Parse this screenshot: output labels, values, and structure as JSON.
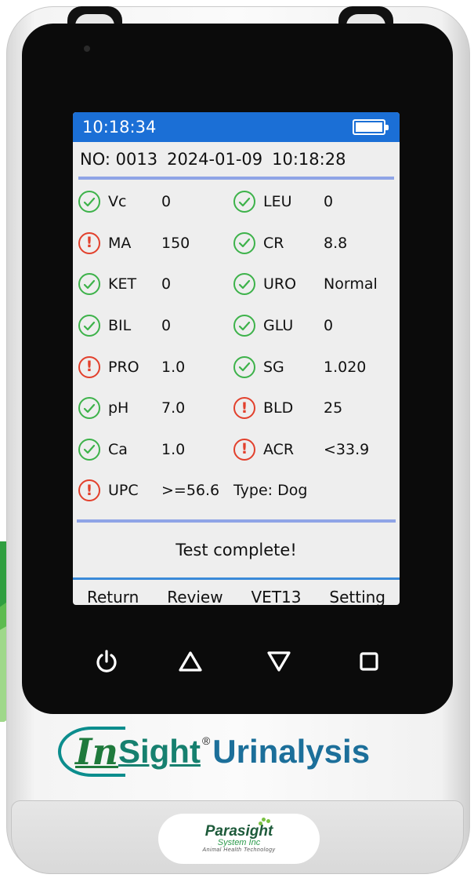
{
  "status_bar": {
    "time": "10:18:34",
    "battery_level": 1.0
  },
  "record": {
    "number": "NO: 0013",
    "date": "2024-01-09",
    "time": "10:18:28"
  },
  "results": [
    [
      {
        "name": "Vc",
        "value": "0",
        "status": "ok"
      },
      {
        "name": "LEU",
        "value": "0",
        "status": "ok"
      }
    ],
    [
      {
        "name": "MA",
        "value": "150",
        "status": "abnormal"
      },
      {
        "name": "CR",
        "value": "8.8",
        "status": "ok"
      }
    ],
    [
      {
        "name": "KET",
        "value": "0",
        "status": "ok"
      },
      {
        "name": "URO",
        "value": "Normal",
        "status": "ok"
      }
    ],
    [
      {
        "name": "BIL",
        "value": "0",
        "status": "ok"
      },
      {
        "name": "GLU",
        "value": "0",
        "status": "ok"
      }
    ],
    [
      {
        "name": "PRO",
        "value": "1.0",
        "status": "abnormal"
      },
      {
        "name": "SG",
        "value": "1.020",
        "status": "ok"
      }
    ],
    [
      {
        "name": "pH",
        "value": "7.0",
        "status": "ok"
      },
      {
        "name": "BLD",
        "value": "25",
        "status": "abnormal"
      }
    ],
    [
      {
        "name": "Ca",
        "value": "1.0",
        "status": "ok"
      },
      {
        "name": "ACR",
        "value": "<33.9",
        "status": "abnormal"
      }
    ]
  ],
  "last_result": {
    "name": "UPC",
    "value": ">=56.6",
    "status": "abnormal",
    "type_text": "Type: Dog"
  },
  "message": "Test complete!",
  "softkeys": [
    "Return",
    "Review",
    "VET13",
    "Setting"
  ],
  "hardware_buttons": [
    "power-icon",
    "up-triangle-icon",
    "down-triangle-icon",
    "square-icon"
  ],
  "colors": {
    "status_bar": "#1b6fd6",
    "ok": "#3db24a",
    "abnormal": "#e2402c",
    "divider": "#8fa4e6"
  },
  "logo": {
    "part1": "In",
    "part2": "Sight",
    "registered": "®",
    "part3": "Urinalysis"
  },
  "brand": {
    "name": "Parasight",
    "line2": "System Inc",
    "line3": "Animal Health Technology"
  }
}
